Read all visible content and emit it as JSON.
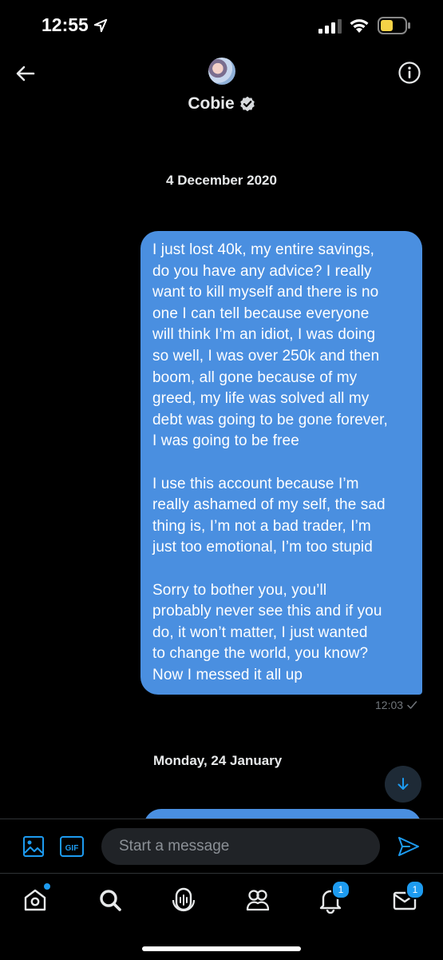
{
  "status_bar": {
    "time": "12:55"
  },
  "header": {
    "contact_name": "Cobie"
  },
  "conversation": {
    "date_separator_1": "4 December 2020",
    "message_1_text": "I just lost 40k, my entire savings,\ndo you have any advice? I really\nwant to kill myself and there is no\none I can tell because everyone\nwill think I’m an idiot, I was doing\nso well, I was over 250k and then\nboom, all gone because of my\ngreed, my life was solved all my\ndebt was going to be gone forever,\nI was going to be free\n\nI use this account because I’m\nreally ashamed of my self, the sad\nthing is, I’m not a bad trader, I’m\njust too emotional, I’m too stupid\n\nSorry to bother you, you’ll\nprobably never see this and if you\ndo, it won’t matter, I just wanted\nto change the world, you know?\nNow I messed it all up",
    "message_1_time": "12:03",
    "date_separator_2": "Monday, 24 January"
  },
  "composer": {
    "placeholder": "Start a message",
    "gif_label": "GIF"
  },
  "tabbar": {
    "notifications_badge": "1",
    "messages_badge": "1"
  },
  "colors": {
    "background": "#000000",
    "bubble": "#4a8fe0",
    "accent": "#1d9bf0"
  }
}
